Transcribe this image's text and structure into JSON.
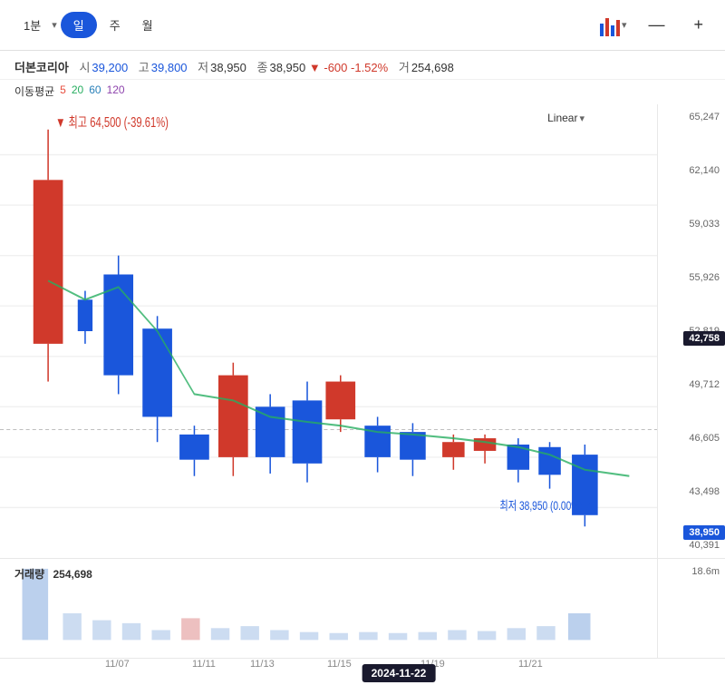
{
  "toolbar": {
    "time_options": [
      "1분",
      "일",
      "주",
      "월"
    ],
    "active_time": "일",
    "dropdown_time": "1분",
    "linear_label": "Linear",
    "minus_label": "—",
    "plus_label": "+"
  },
  "stock": {
    "name": "더본코리아",
    "open_label": "시",
    "open_value": "39,200",
    "high_label": "고",
    "high_value": "39,800",
    "low_label": "저",
    "low_value": "38,950",
    "close_label": "종",
    "close_value": "38,950",
    "change": "-600",
    "change_pct": "-1.52%",
    "volume_label": "거",
    "volume_value": "254,698"
  },
  "ma": {
    "label": "이동평균",
    "values": [
      "5",
      "20",
      "60",
      "120"
    ]
  },
  "y_axis": {
    "labels": [
      "65,247",
      "62,140",
      "59,033",
      "55,926",
      "52,819",
      "49,712",
      "46,605",
      "43,498",
      "40,391"
    ],
    "current_price": "42,758",
    "last_price": "38,950"
  },
  "volume": {
    "label": "거래량",
    "value": "254,698",
    "y_label": "18.6m"
  },
  "date_axis": {
    "labels": [
      "11/07",
      "11/11",
      "11/13",
      "11/15",
      "11/19",
      "11/21"
    ],
    "current_date": "2024-11-22"
  },
  "annotations": {
    "high": "▼ 최고 64,500 (-39.61%)",
    "low": "최저 38,950 (0.00%) ▲"
  }
}
